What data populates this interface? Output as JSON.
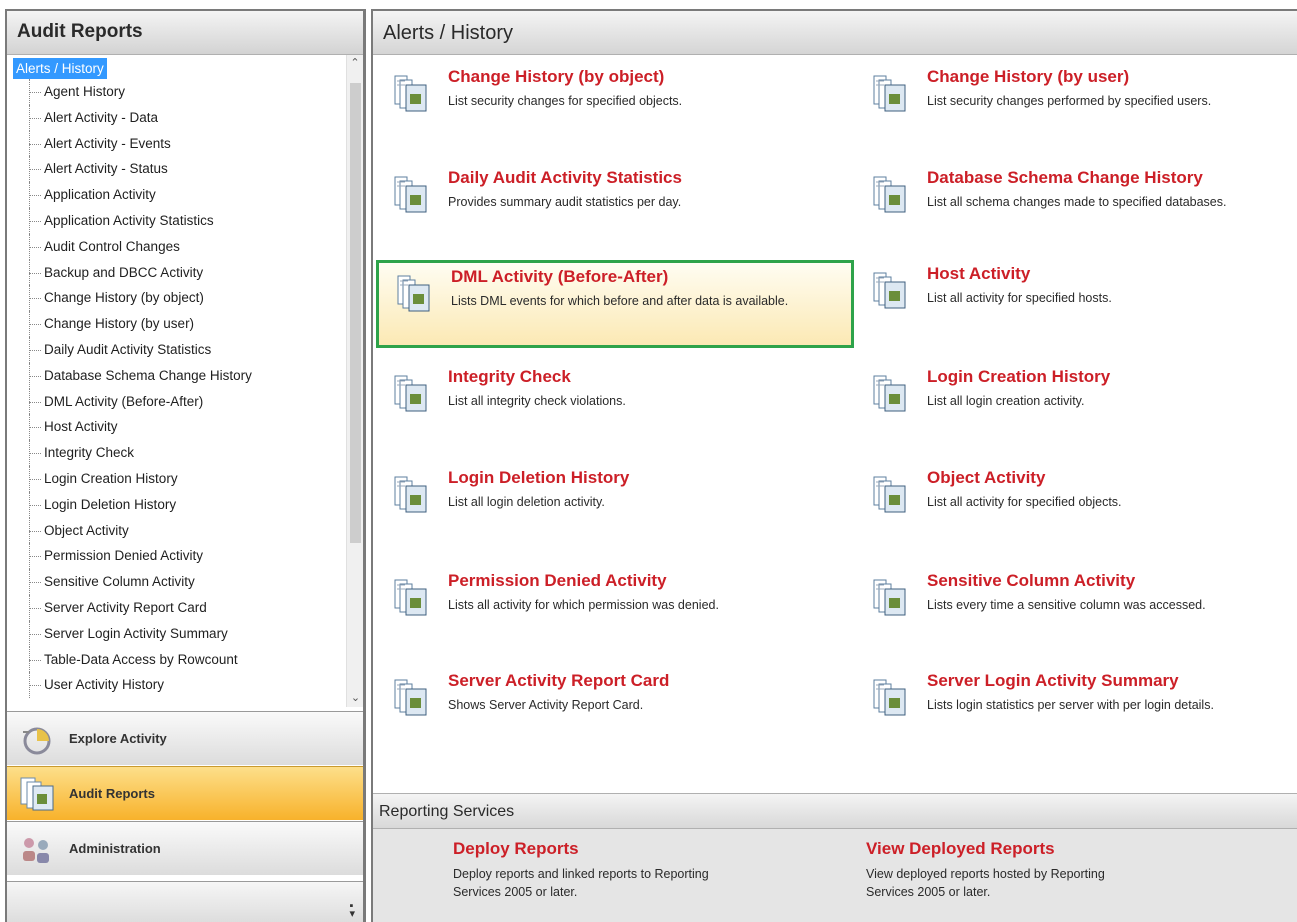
{
  "left": {
    "title": "Audit Reports",
    "tree_root": "Alerts / History",
    "tree_items": [
      "Agent History",
      "Alert Activity - Data",
      "Alert Activity - Events",
      "Alert Activity - Status",
      "Application Activity",
      "Application Activity Statistics",
      "Audit Control Changes",
      "Backup and DBCC Activity",
      "Change History (by object)",
      "Change History (by user)",
      "Daily Audit Activity Statistics",
      "Database Schema Change History",
      "DML Activity (Before-After)",
      "Host Activity",
      "Integrity Check",
      "Login Creation History",
      "Login Deletion History",
      "Object Activity",
      "Permission Denied Activity",
      "Sensitive Column Activity",
      "Server Activity Report Card",
      "Server Login Activity Summary",
      "Table-Data Access by Rowcount",
      "User Activity History"
    ],
    "nav": [
      {
        "label": "Explore Activity",
        "icon": "explore-activity-icon",
        "active": false
      },
      {
        "label": "Audit Reports",
        "icon": "audit-reports-icon",
        "active": true
      },
      {
        "label": "Administration",
        "icon": "administration-icon",
        "active": false
      }
    ]
  },
  "main": {
    "title": "Alerts / History",
    "reports": [
      {
        "title": "Change History (by object)",
        "desc": "List security changes for specified objects."
      },
      {
        "title": "Change History (by user)",
        "desc": "List security changes performed by specified users."
      },
      {
        "title": "Daily Audit Activity Statistics",
        "desc": "Provides summary audit statistics per day."
      },
      {
        "title": "Database Schema Change History",
        "desc": "List all schema changes made to specified databases."
      },
      {
        "title": "DML Activity (Before-After)",
        "desc": "Lists DML events for which before and after data is available."
      },
      {
        "title": "Host Activity",
        "desc": "List all activity for specified hosts."
      },
      {
        "title": "Integrity Check",
        "desc": "List all integrity check violations."
      },
      {
        "title": "Login Creation History",
        "desc": "List all login creation activity."
      },
      {
        "title": "Login Deletion History",
        "desc": "List all login deletion activity."
      },
      {
        "title": "Object Activity",
        "desc": "List all activity for specified objects."
      },
      {
        "title": "Permission Denied Activity",
        "desc": "Lists all activity for which permission was denied."
      },
      {
        "title": "Sensitive Column Activity",
        "desc": "Lists every time a sensitive column was accessed."
      },
      {
        "title": "Server Activity Report Card",
        "desc": "Shows Server Activity Report Card."
      },
      {
        "title": "Server Login Activity Summary",
        "desc": "Lists login statistics per server with per login details."
      }
    ],
    "reporting_services": {
      "title": "Reporting Services",
      "deploy": {
        "title": "Deploy Reports",
        "desc": "Deploy reports and linked reports to Reporting Services 2005 or later."
      },
      "view": {
        "title": "View Deployed Reports",
        "desc": "View deployed reports hosted by Reporting Services 2005 or later."
      }
    }
  },
  "colors": {
    "link": "#cc1f27",
    "selection": "#3399ff",
    "highlight_border": "#2ea34a",
    "active_nav": "#f8b22b"
  }
}
